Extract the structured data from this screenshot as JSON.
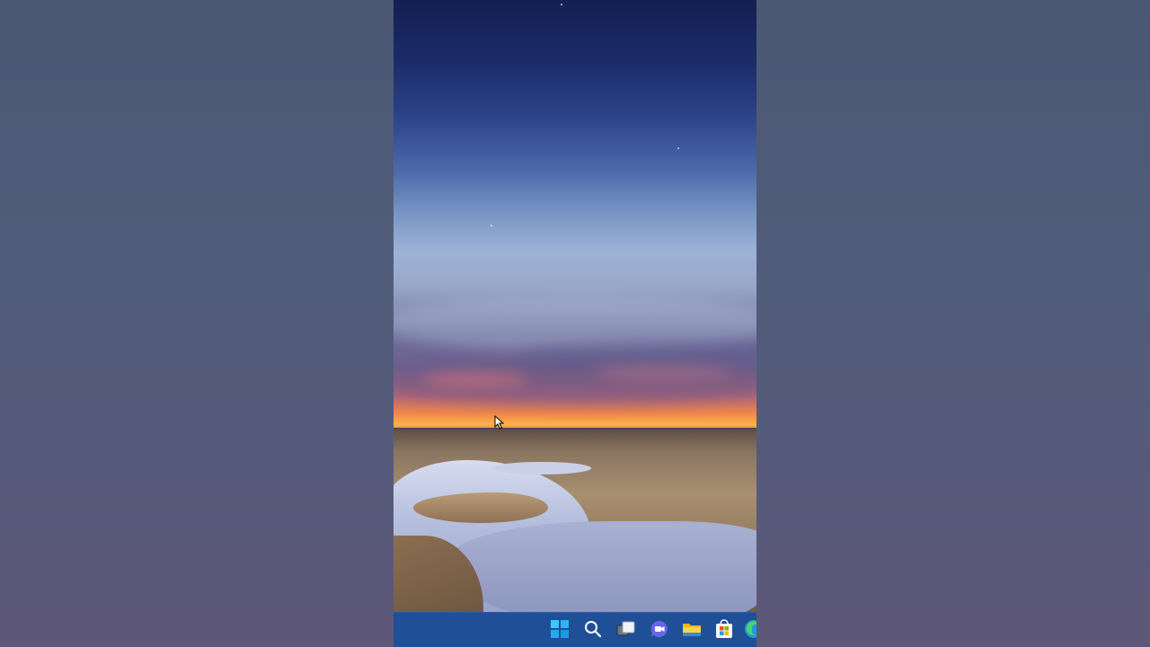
{
  "desktop": {
    "wallpaper": "sunset-lake-landscape",
    "background_color": "#515d7a"
  },
  "taskbar": {
    "color": "#1f4f96",
    "items": [
      {
        "name": "start",
        "icon": "windows-logo-icon"
      },
      {
        "name": "search",
        "icon": "search-icon"
      },
      {
        "name": "task-view",
        "icon": "task-view-icon"
      },
      {
        "name": "chat",
        "icon": "teams-chat-icon"
      },
      {
        "name": "file-explorer",
        "icon": "folder-icon"
      },
      {
        "name": "microsoft-store",
        "icon": "store-icon"
      },
      {
        "name": "edge",
        "icon": "edge-icon"
      }
    ]
  },
  "cursor": {
    "icon": "arrow-cursor-icon"
  }
}
